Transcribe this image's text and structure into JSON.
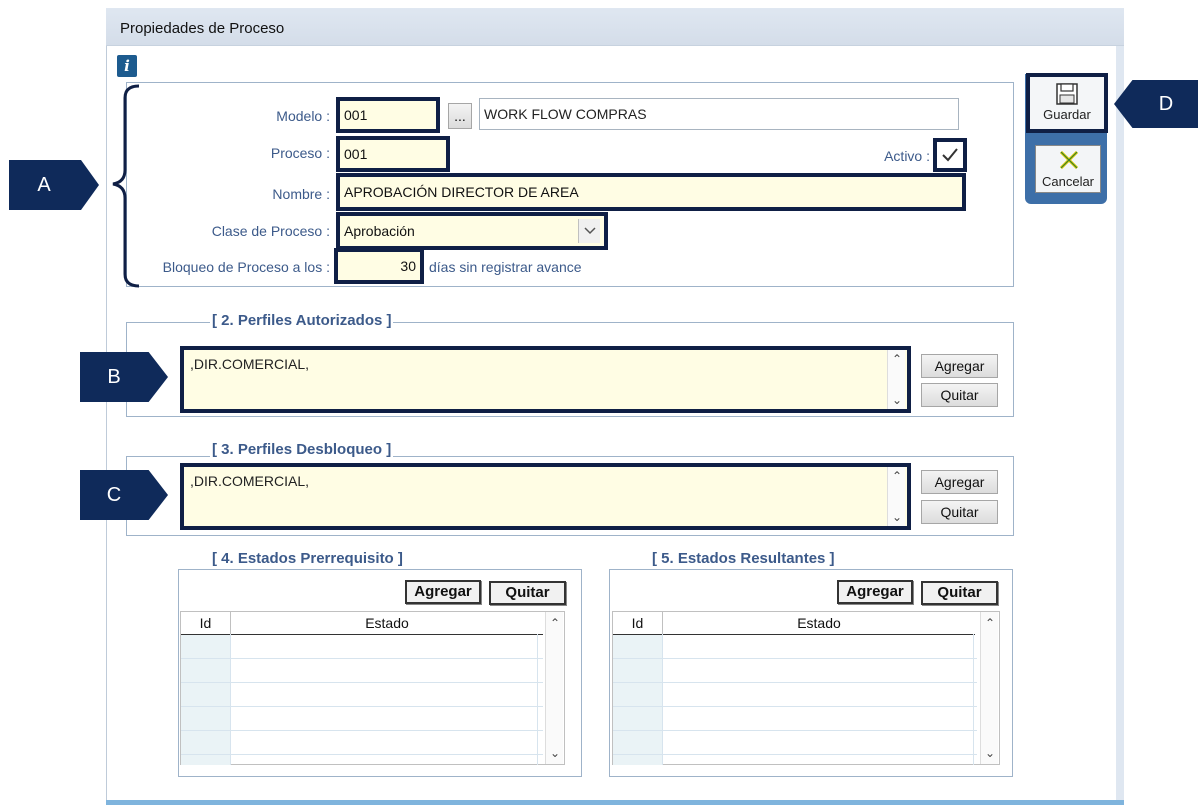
{
  "window": {
    "title": "Propiedades de  Proceso"
  },
  "info_icon": "info-icon",
  "section1": {
    "modelo_label": "Modelo :",
    "modelo_value": "001",
    "browse_label": "...",
    "modelo_desc": "WORK FLOW COMPRAS",
    "proceso_label": "Proceso :",
    "proceso_value": "001",
    "activo_label": "Activo :",
    "activo_checked": true,
    "nombre_label": "Nombre :",
    "nombre_value": "APROBACIÓN DIRECTOR DE AREA",
    "clase_label": "Clase de Proceso :",
    "clase_value": "Aprobación",
    "bloqueo_label": "Bloqueo de Proceso a los :",
    "bloqueo_value": "30",
    "bloqueo_suffix": "días sin registrar avance"
  },
  "section2": {
    "title": "[ 2. Perfiles Autorizados ]",
    "value": ",DIR.COMERCIAL,",
    "add_label": "Agregar",
    "remove_label": "Quitar"
  },
  "section3": {
    "title": "[ 3. Perfiles Desbloqueo ]",
    "value": ",DIR.COMERCIAL,",
    "add_label": "Agregar",
    "remove_label": "Quitar"
  },
  "section4": {
    "title": "[ 4. Estados Prerrequisito ]",
    "add_label": "Agregar",
    "remove_label": "Quitar",
    "columns": [
      "Id",
      "Estado"
    ]
  },
  "section5": {
    "title": "[ 5. Estados Resultantes ]",
    "add_label": "Agregar",
    "remove_label": "Quitar",
    "columns": [
      "Id",
      "Estado"
    ]
  },
  "toolbar": {
    "save_label": "Guardar",
    "cancel_label": "Cancelar"
  },
  "callouts": {
    "a": "A",
    "b": "B",
    "c": "C",
    "d": "D"
  },
  "colors": {
    "highlight": "#0f1f45",
    "callout": "#0f2a5a",
    "label": "#3c5a8a",
    "field_bg": "#fffde4"
  }
}
